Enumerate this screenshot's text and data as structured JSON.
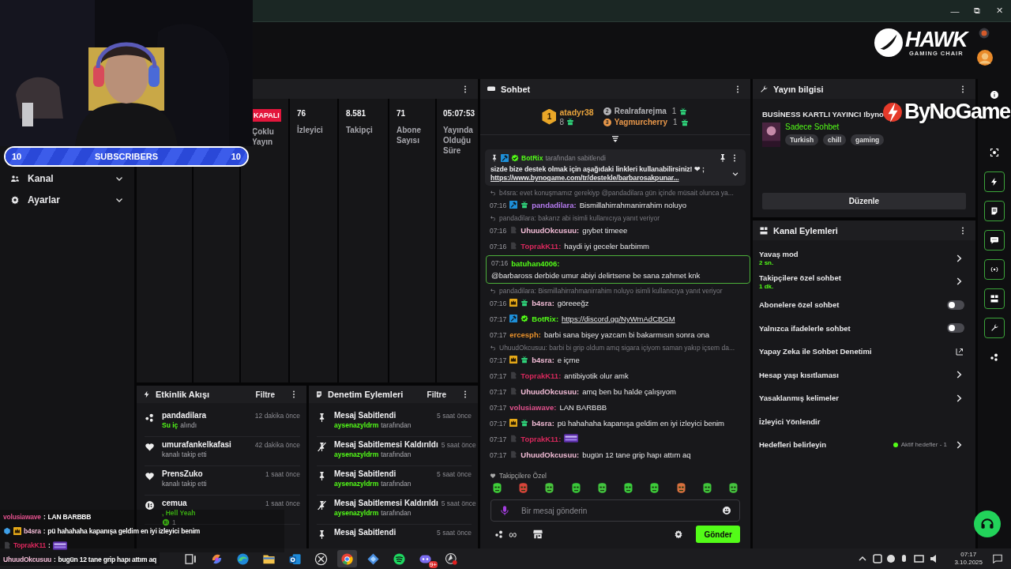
{
  "window": {
    "controls": [
      "—",
      "⧉",
      "✕"
    ]
  },
  "sub_goal": {
    "current": "10",
    "label": "SUBSCRIBERS",
    "target": "10",
    "level": 1
  },
  "overlay_logo": {
    "name": "HAWK",
    "tagline": "GAMING CHAIR"
  },
  "sponsor_logo": {
    "name": "ByNoGame"
  },
  "sidebar": {
    "items": [
      {
        "label": "Kanal",
        "expanded": false
      },
      {
        "label": "Ayarlar",
        "expanded": false
      }
    ]
  },
  "stats": {
    "columns": [
      {
        "badge": "KAPALI",
        "label": "Çoklu Yayın"
      },
      {
        "value": "76",
        "label": "İzleyici"
      },
      {
        "value": "8.581",
        "label": "Takipçi"
      },
      {
        "value": "71",
        "label": "Abone Sayısı"
      },
      {
        "value": "05:07:53",
        "label": "Yayında Olduğu Süre"
      }
    ]
  },
  "event_feed": {
    "title": "Etkinlik Akışı",
    "filter": "Filtre",
    "items": [
      {
        "kind": "reward",
        "user": "pandadilara",
        "highlight": "Su iç",
        "text": "alındı",
        "time": "12 dakika önce"
      },
      {
        "kind": "follow",
        "user": "umurafankelkafasi",
        "text": "kanalı takip etti",
        "time": "42 dakika önce"
      },
      {
        "kind": "follow",
        "user": "PrensZuko",
        "text": "kanalı takip etti",
        "time": "1 saat önce"
      },
      {
        "kind": "kicks",
        "user": "cemua",
        "highlight": ", Hell Yeah",
        "amount": "1",
        "time": "1 saat önce"
      }
    ]
  },
  "moderation": {
    "title": "Denetim Eylemleri",
    "filter": "Filtre",
    "items": [
      {
        "kind": "pin",
        "action": "Mesaj Sabitlendi",
        "by": "aysenazyldrm",
        "suffix": "tarafından",
        "time": "5 saat önce"
      },
      {
        "kind": "unpin",
        "action": "Mesaj Sabitlemesi Kaldırıldı",
        "by": "aysenazyldrm",
        "suffix": "tarafından",
        "time": "5 saat önce"
      },
      {
        "kind": "pin",
        "action": "Mesaj Sabitlendi",
        "by": "aysenazyldrm",
        "suffix": "tarafından",
        "time": "5 saat önce"
      },
      {
        "kind": "unpin",
        "action": "Mesaj Sabitlemesi Kaldırıldı",
        "by": "aysenazyldrm",
        "suffix": "tarafından",
        "time": "5 saat önce"
      },
      {
        "kind": "pin",
        "action": "Mesaj Sabitlendi",
        "time": "5 saat önce"
      }
    ]
  },
  "chat": {
    "title": "Sohbet",
    "leaderboard": [
      {
        "rank": "1",
        "user": "atadyr38",
        "count": "8",
        "color": "#e8a33c"
      },
      {
        "rank": "2",
        "user": "Realrafarejma",
        "count": "1",
        "color": "#b4b4b8"
      },
      {
        "rank": "3",
        "user": "Yagmurcherry",
        "count": "1",
        "color": "#e8974a"
      }
    ],
    "pinned": {
      "badges": [
        {
          "kind": "mod"
        },
        {
          "kind": "verified"
        }
      ],
      "by_user": "BotRix",
      "by_text": "tarafından sabitlendi",
      "text": "sizde bize destek olmak için aşağıdaki linkleri kullanabilirsiniz! ❤ ;",
      "link": "https://www.bynogame.com/tr/destekle/barbarosakpunar..."
    },
    "messages": [
      {
        "kind": "text",
        "reply_to": "b4sra: evet konuşmamız gerekiyp @pandadilara gün içinde müsait olunca ya...",
        "time": "07:16",
        "badges": [
          {
            "kind": "mod"
          },
          {
            "kind": "sub"
          }
        ],
        "user": "pandadilara:",
        "color": "#b77cf2",
        "text": "Bismillahirrahmanirrahim noluyo",
        "highlighted": false
      },
      {
        "kind": "text",
        "reply_to": "pandadilara: bakarız abi isimli kullanıcıya yanıt veriyor",
        "time": "07:16",
        "badges": [
          {
            "kind": "og"
          }
        ],
        "user": "UhuudOkcusuu:",
        "color": "#f2bcd6",
        "text": "gıybet timeee",
        "highlighted": false
      },
      {
        "kind": "text",
        "time": "07:16",
        "badges": [
          {
            "kind": "og"
          }
        ],
        "user": "ToprakK11:",
        "color": "#d8285c",
        "text": "haydi iyi geceler barbimm",
        "highlighted": false
      },
      {
        "kind": "text",
        "time": "07:16",
        "user": "batuhan4006:",
        "color": "#53fc18",
        "text": "@barbaross derbide umur abiyi delirtsene be sana zahmet knk",
        "highlighted": true
      },
      {
        "kind": "text",
        "reply_to": "pandadilara: Bismillahirrahmanirrahim noluyo isimli kullanıcıya yanıt veriyor",
        "time": "07:16",
        "badges": [
          {
            "kind": "crown"
          },
          {
            "kind": "sub"
          }
        ],
        "user": "b4sra:",
        "color": "#f2bcd6",
        "text": "göreeeğz",
        "highlighted": false
      },
      {
        "kind": "link",
        "time": "07:17",
        "badges": [
          {
            "kind": "mod"
          },
          {
            "kind": "verified"
          }
        ],
        "user": "BotRix:",
        "color": "#53fc18",
        "text": "https://discord.gg/NyWmAdCBGM",
        "highlighted": false
      },
      {
        "kind": "text",
        "time": "07:17",
        "user": "ercesph:",
        "color": "#e8902a",
        "text": "barbi sana bişey yazcam bi bakarmısın sonra ona",
        "highlighted": false
      },
      {
        "kind": "text",
        "reply_to": "UhuudOkcusuu: barbi bi grip oldum amq sigara içiyom saman yakıp içsem da...",
        "time": "07:17",
        "badges": [
          {
            "kind": "crown"
          },
          {
            "kind": "sub"
          }
        ],
        "user": "b4sra:",
        "color": "#f2bcd6",
        "text": "e içme",
        "highlighted": false
      },
      {
        "kind": "text",
        "time": "07:17",
        "badges": [
          {
            "kind": "og"
          }
        ],
        "user": "ToprakK11:",
        "color": "#d8285c",
        "text": "antibiyotik olur amk",
        "highlighted": false
      },
      {
        "kind": "text",
        "time": "07:17",
        "badges": [
          {
            "kind": "og"
          }
        ],
        "user": "UhuudOkcusuu:",
        "color": "#f2bcd6",
        "text": "amq ben bu halde çalışıyom",
        "highlighted": false
      },
      {
        "kind": "text",
        "time": "07:17",
        "user": "volusiawave:",
        "color": "#e0508c",
        "text": "LAN BARBBB",
        "highlighted": false
      },
      {
        "kind": "text",
        "time": "07:17",
        "badges": [
          {
            "kind": "crown"
          },
          {
            "kind": "sub"
          }
        ],
        "user": "b4sra:",
        "color": "#f2bcd6",
        "text": "pü hahahaha kapanışa geldim en iyi izleyici benim",
        "highlighted": false
      },
      {
        "kind": "emote",
        "time": "07:17",
        "badges": [
          {
            "kind": "og"
          }
        ],
        "user": "ToprakK11:",
        "color": "#d8285c",
        "highlighted": false
      },
      {
        "kind": "text",
        "time": "07:17",
        "badges": [
          {
            "kind": "og"
          }
        ],
        "user": "UhuudOkcusuu:",
        "color": "#f2bcd6",
        "text": "bugün 12 tane grip hapı attım aq",
        "highlighted": false
      }
    ],
    "followers_label": "Takipçilere Özel",
    "input": {
      "placeholder": "Bir mesaj gönderin"
    },
    "points": "∞",
    "send": "Gönder"
  },
  "stream_info": {
    "title": "Yayın bilgisi",
    "stream_title": "BUSİNESS KARTLI YAYINCI !byno",
    "category": "Sadece Sohbet",
    "tags": [
      "Turkish",
      "chill",
      "gaming"
    ],
    "edit": "Düzenle"
  },
  "channel_actions": {
    "title": "Kanal Eylemleri",
    "items": [
      {
        "kind": "link",
        "label": "Yavaş mod",
        "value": "2 sn."
      },
      {
        "kind": "link",
        "label": "Takipçilere özel sohbet",
        "value": "1 dk."
      },
      {
        "kind": "toggle",
        "label": "Abonelere özel sohbet",
        "on": false
      },
      {
        "kind": "toggle",
        "label": "Yalnızca ifadelerle sohbet",
        "on": false
      },
      {
        "kind": "external",
        "label": "Yapay Zeka ile Sohbet Denetimi"
      },
      {
        "kind": "link",
        "label": "Hesap yaşı kısıtlaması"
      },
      {
        "kind": "link",
        "label": "Yasaklanmış kelimeler"
      },
      {
        "kind": "plain",
        "label": "İzleyici Yönlendir"
      },
      {
        "kind": "link",
        "label": "Hedefleri belirleyin",
        "status": "Aktif hedefler - 1"
      }
    ]
  },
  "rail": [
    {
      "kind": "info",
      "active": false
    },
    {
      "kind": "focus",
      "active": false
    },
    {
      "kind": "bolt",
      "active": true
    },
    {
      "kind": "notes",
      "active": true
    },
    {
      "kind": "chat",
      "active": true
    },
    {
      "kind": "broadcast",
      "active": true
    },
    {
      "kind": "layout",
      "active": true
    },
    {
      "kind": "wrench",
      "active": true
    },
    {
      "kind": "dots",
      "active": false
    }
  ],
  "stream_chat_overlay": [
    {
      "kind": "text",
      "user": "volusiawave",
      "color": "#e0508c",
      "separator": ":",
      "text": "LAN BARBBB"
    },
    {
      "kind": "text",
      "badges": [
        {
          "kind": "cube"
        },
        {
          "kind": "crown"
        }
      ],
      "user": "b4sra",
      "color": "#f2bcd6",
      "separator": ":",
      "text": "pü hahahaha kapanışa geldim en iyi izleyici benim"
    },
    {
      "kind": "emote",
      "badges": [
        {
          "kind": "og"
        }
      ],
      "user": "ToprakK11",
      "color": "#d8285c",
      "separator": ":"
    },
    {
      "kind": "text",
      "user": "UhuudOkcusuu",
      "color": "#f2bcd6",
      "separator": ":",
      "text": "bugün 12 tane grip hapı attım aq"
    }
  ],
  "taskbar": {
    "apps": [
      {
        "kind": "taskview",
        "selected": false
      },
      {
        "kind": "swirl",
        "selected": false
      },
      {
        "kind": "wave",
        "selected": false
      },
      {
        "kind": "folder",
        "selected": false
      },
      {
        "kind": "mail",
        "selected": false
      },
      {
        "kind": "expand",
        "selected": false
      },
      {
        "kind": "browser",
        "selected": true
      },
      {
        "kind": "diamond",
        "selected": false
      },
      {
        "kind": "music",
        "selected": false
      },
      {
        "kind": "controller",
        "selected": false,
        "badge": "9+"
      },
      {
        "kind": "record",
        "selected": false
      }
    ],
    "time": "07:17",
    "date": "3.10.2025"
  }
}
